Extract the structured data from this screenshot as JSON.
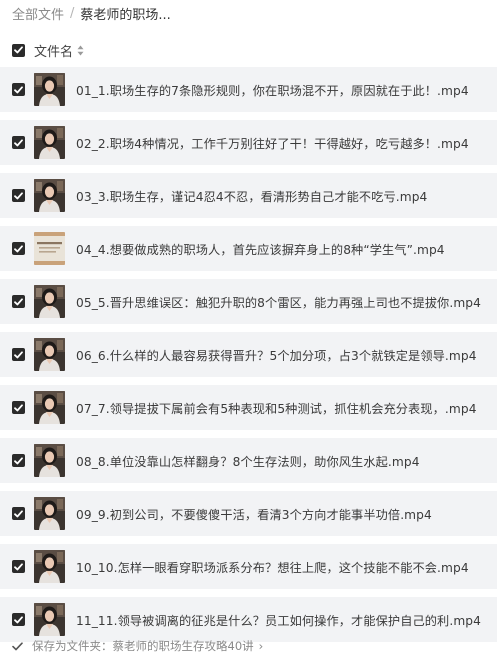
{
  "breadcrumb": {
    "root": "全部文件",
    "separator": "/",
    "current": "蔡老师的职场..."
  },
  "header": {
    "column_label": "文件名",
    "sort_icon": "sort-icon"
  },
  "files": [
    {
      "name": "01_1.职场生存的7条隐形规则，你在职场混不开，原因就在于此！.mp4",
      "thumb": "portrait",
      "checked": true
    },
    {
      "name": "02_2.职场4种情况，工作千万别往好了干！干得越好，吃亏越多！.mp4",
      "thumb": "portrait",
      "checked": true
    },
    {
      "name": "03_3.职场生存，谨记4忍4不忍，看清形势自己才能不吃亏.mp4",
      "thumb": "portrait",
      "checked": true
    },
    {
      "name": "04_4.想要做成熟的职场人，首先应该摒弃身上的8种“学生气”.mp4",
      "thumb": "slide",
      "checked": true
    },
    {
      "name": "05_5.晋升思维误区：触犯升职的8个雷区，能力再强上司也不提拔你.mp4",
      "thumb": "portrait",
      "checked": true
    },
    {
      "name": "06_6.什么样的人最容易获得晋升？5个加分项，占3个就铁定是领导.mp4",
      "thumb": "portrait",
      "checked": true
    },
    {
      "name": "07_7.领导提拔下属前会有5种表现和5种测试，抓住机会充分表现，.mp4",
      "thumb": "portrait",
      "checked": true
    },
    {
      "name": "08_8.单位没靠山怎样翻身？8个生存法则，助你风生水起.mp4",
      "thumb": "portrait",
      "checked": true
    },
    {
      "name": "09_9.初到公司，不要傻傻干活，看清3个方向才能事半功倍.mp4",
      "thumb": "portrait",
      "checked": true
    },
    {
      "name": "10_10.怎样一眼看穿职场派系分布？想往上爬，这个技能不能不会.mp4",
      "thumb": "portrait",
      "checked": true
    },
    {
      "name": "11_11.领导被调离的征兆是什么？员工如何操作，才能保护自己的利.mp4",
      "thumb": "portrait",
      "checked": true
    }
  ],
  "footer": {
    "text": "保存为文件夹：蔡老师的职场生存攻略40讲",
    "chevron": "›"
  },
  "colors": {
    "row_bg": "#f2f3f5",
    "checkbox": "#2b2b2b",
    "muted_text": "#8a8a8a"
  }
}
